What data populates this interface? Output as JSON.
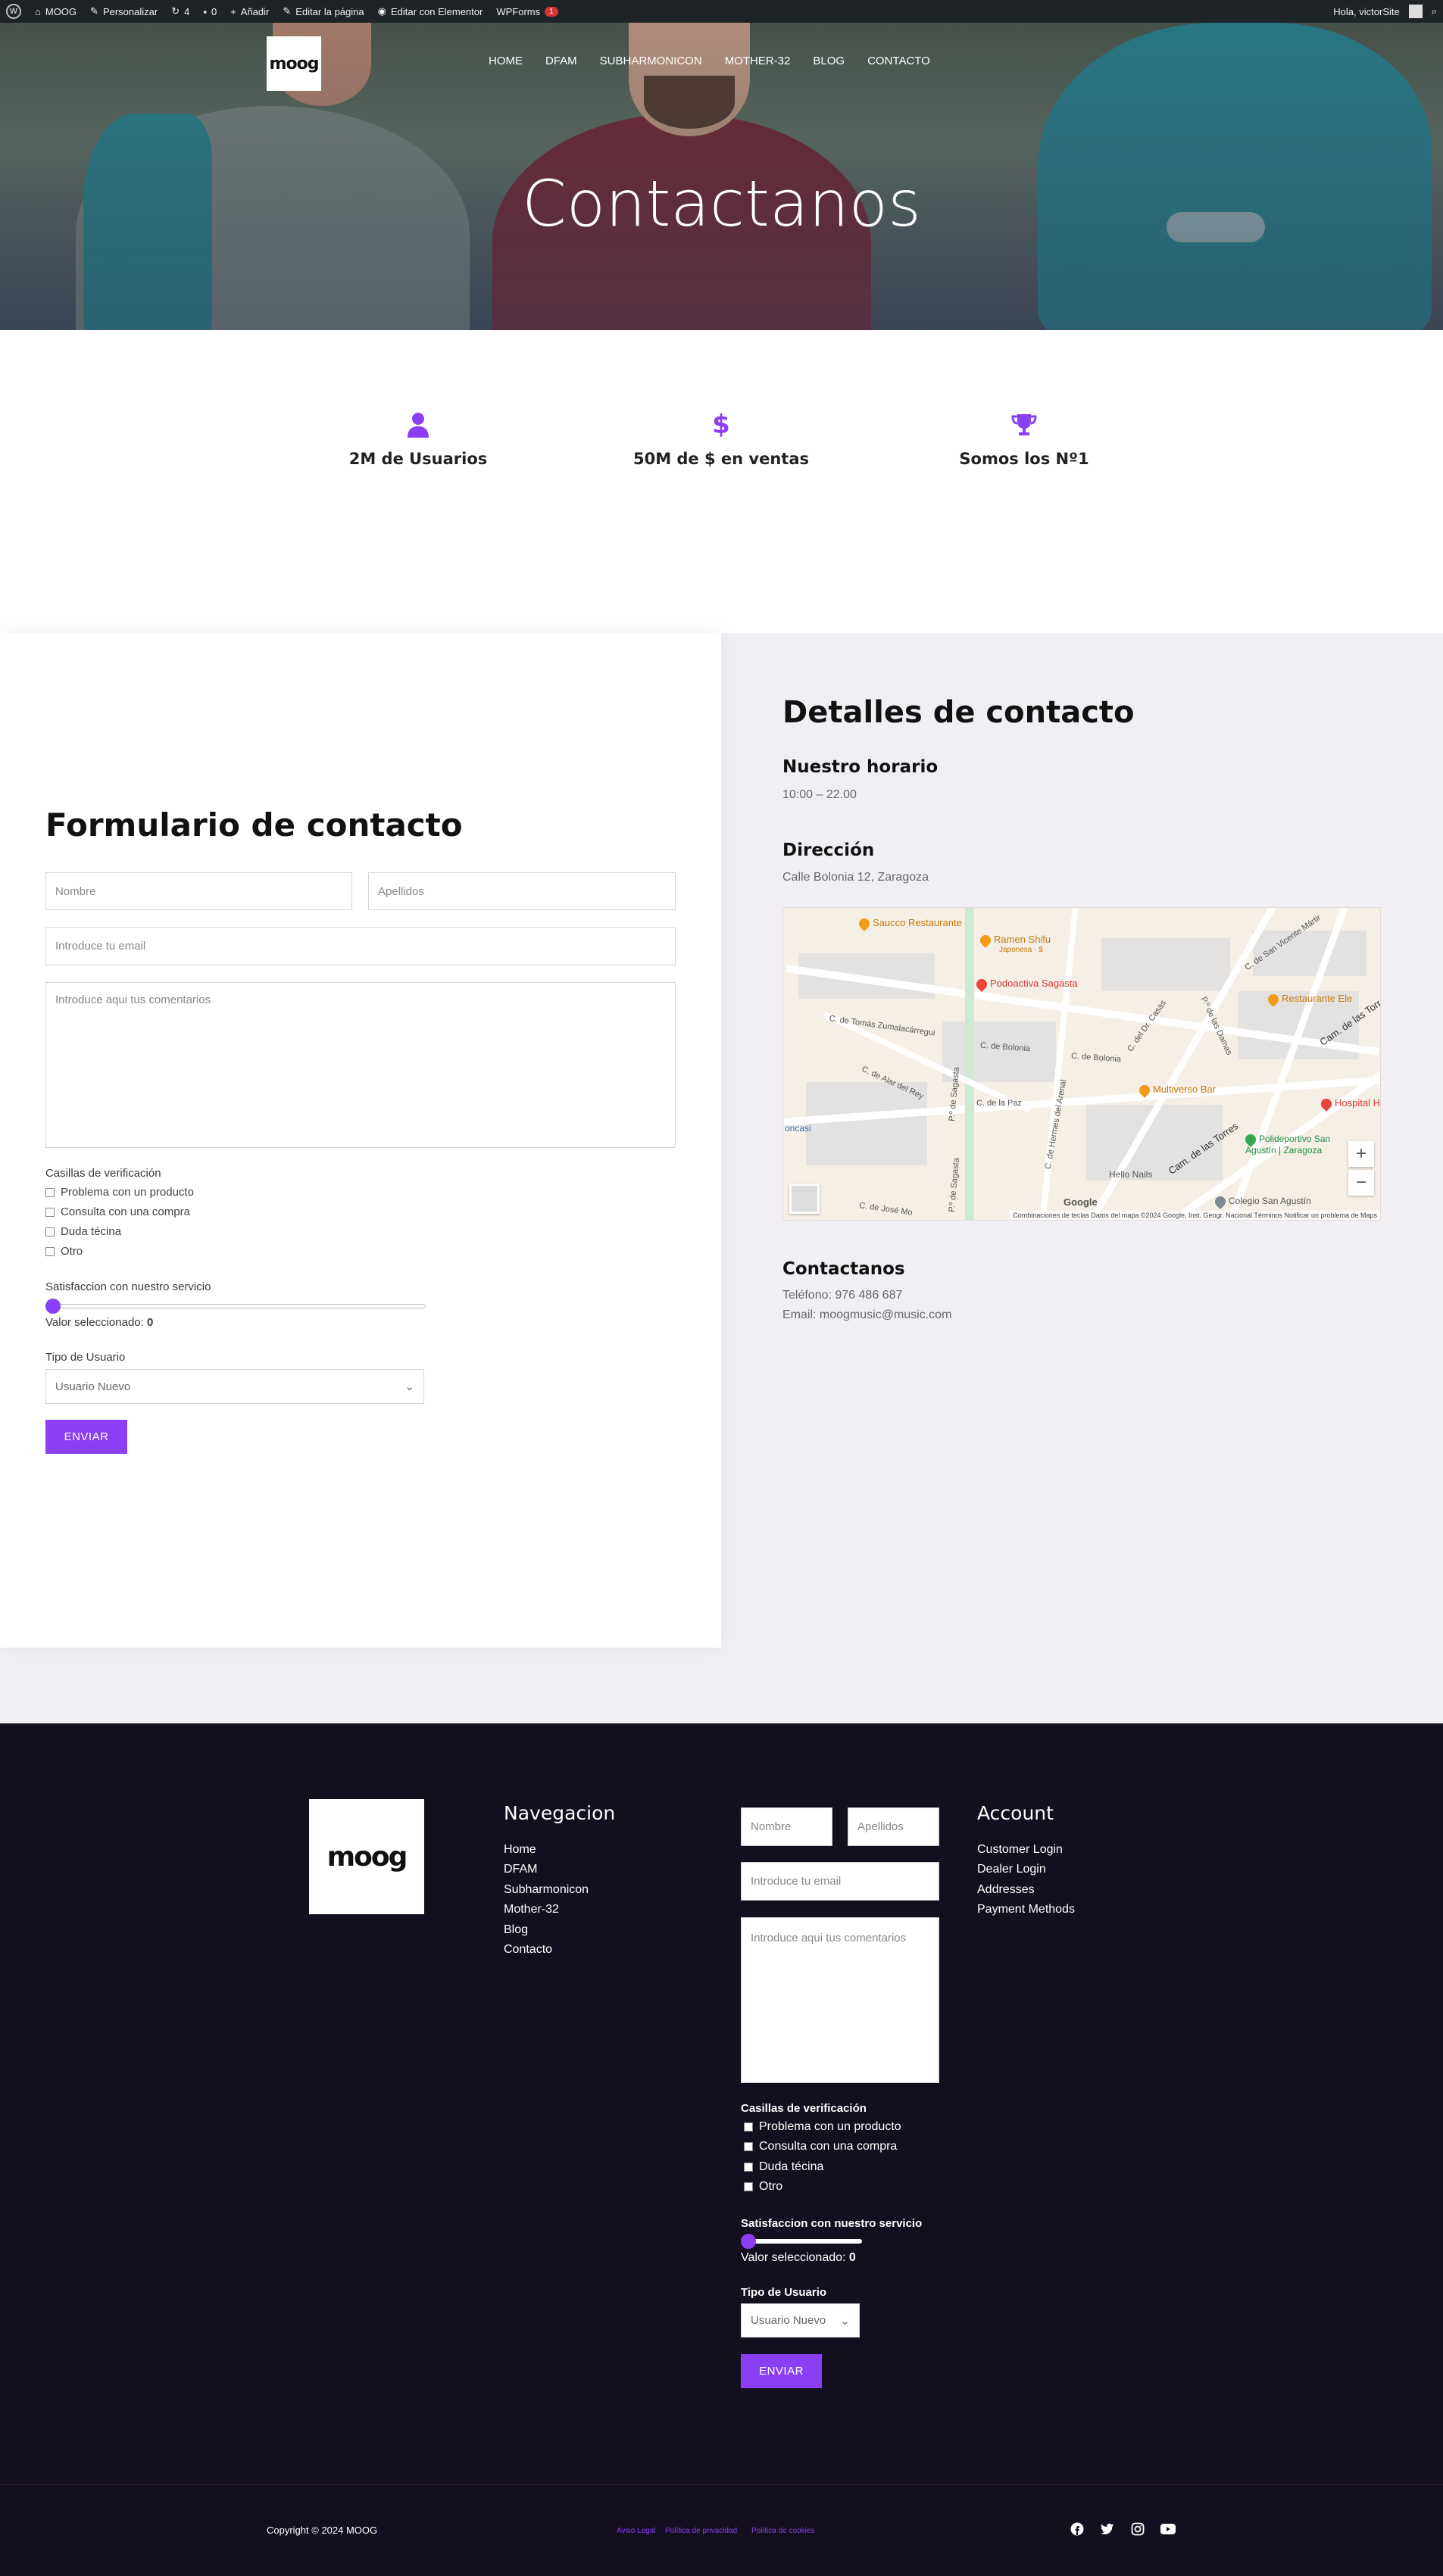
{
  "admin_bar": {
    "site": "MOOG",
    "customize": "Personalizar",
    "updates": "4",
    "comments": "0",
    "add": "Añadir",
    "edit_page": "Editar la página",
    "elementor": "Editar con Elementor",
    "wpforms": "WPForms",
    "wpforms_badge": "1",
    "greeting": "Hola, victorSite"
  },
  "header": {
    "logo": "moog",
    "nav": [
      "HOME",
      "DFAM",
      "SUBHARMONICON",
      "MOTHER-32",
      "BLOG",
      "CONTACTO"
    ]
  },
  "hero": {
    "title": "Contactanos"
  },
  "features": [
    {
      "icon": "user-icon",
      "label": "2M de Usuarios"
    },
    {
      "icon": "dollar-icon",
      "label": "50M de $ en ventas"
    },
    {
      "icon": "trophy-icon",
      "label": "Somos los Nº1"
    }
  ],
  "form": {
    "title": "Formulario de contacto",
    "first_name_ph": "Nombre",
    "last_name_ph": "Apellidos",
    "email_ph": "Introduce tu email",
    "comments_ph": "Introduce aqui tus comentarios",
    "checkbox_label": "Casillas de verificación",
    "checkboxes": [
      "Problema con un producto",
      "Consulta con una compra",
      "Duda técina",
      "Otro"
    ],
    "slider_label": "Satisfaccion con nuestro servicio",
    "selected_prefix": "Valor seleccionado:",
    "selected_value": "0",
    "user_type_label": "Tipo de Usuario",
    "user_type_value": "Usuario Nuevo",
    "submit": "ENVIAR"
  },
  "details": {
    "title": "Detalles de contacto",
    "hours_heading": "Nuestro horario",
    "hours": "10:00 – 22.00",
    "address_heading": "Dirección",
    "address": "Calle Bolonia 12, Zaragoza",
    "contact_heading": "Contactanos",
    "phone": "Teléfono: 976 486 687",
    "email": "Email: moogmusic@music.com"
  },
  "map": {
    "places": [
      "Saucco Restaurante",
      "Ramen Shifu",
      "Japonesa · $",
      "Podoactiva Sagasta",
      "Restaurante Ele",
      "Multiverso Bar",
      "Hospital HC",
      "Polideportivo San Agustín | Zaragoza",
      "Hello Nails",
      "Colegio San Agustín",
      "oncasi"
    ],
    "streets": [
      "C. de Tomás Zumalacárregui",
      "C. de Bolonia",
      "C. de Bolonia",
      "C. de Alar del Rey",
      "C. de la Paz",
      "P.º de Sagasta",
      "P.º de Sagasta",
      "C. de Hermes del Arenal",
      "C. del Dr. Casas",
      "P.º de las Damas",
      "C. de San Vicente Mártir",
      "Cam. de las Torres",
      "Cam. de las Torres",
      "C. de José Mo"
    ],
    "attribution": "Combinaciones de teclas   Datos del mapa ©2024 Google, Inst. Geogr. Nacional   Términos   Notificar un problema de Maps",
    "google": "Google",
    "zoom_in": "+",
    "zoom_out": "−"
  },
  "footer": {
    "logo": "moog",
    "nav_heading": "Navegacion",
    "nav_links": [
      "Home",
      "DFAM",
      "Subharmonicon",
      "Mother-32",
      "Blog",
      "Contacto"
    ],
    "account_heading": "Account",
    "account_links": [
      "Customer Login",
      "Dealer Login",
      "Addresses",
      "Payment Methods"
    ],
    "form": {
      "first_name_ph": "Nombre",
      "last_name_ph": "Apellidos",
      "email_ph": "Introduce tu email",
      "comments_ph": "Introduce aqui tus comentarios",
      "checkbox_label": "Casillas de verificación",
      "checkboxes": [
        "Problema con un producto",
        "Consulta con una compra",
        "Duda técina",
        "Otro"
      ],
      "slider_label": "Satisfaccion con nuestro servicio",
      "selected_prefix": "Valor seleccionado:",
      "selected_value": "0",
      "user_type_label": "Tipo de Usuario",
      "user_type_value": "Usuario Nuevo",
      "submit": "ENVIAR"
    },
    "copyright": "Copyright © 2024 MOOG",
    "legal": [
      "Aviso Legal",
      "Política de privacidad",
      "Política de cookies"
    ],
    "social": [
      "facebook-icon",
      "twitter-icon",
      "instagram-icon",
      "youtube-icon"
    ]
  },
  "colors": {
    "accent": "#8a3ff5",
    "footer_bg": "#140f1e",
    "panel_bg": "#f1eff4",
    "admin_bg": "#1d2327"
  }
}
